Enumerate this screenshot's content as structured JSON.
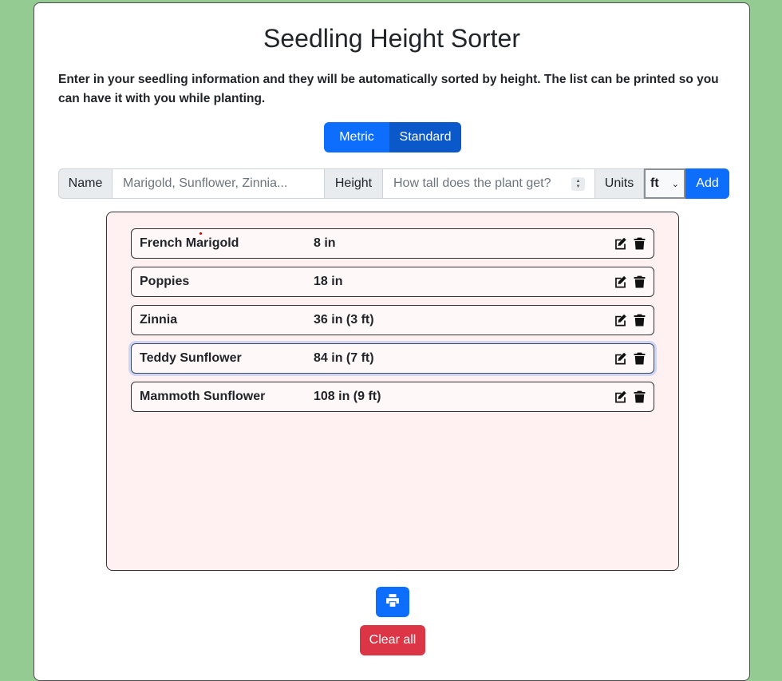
{
  "header": {
    "title": "Seedling Height Sorter",
    "description": "Enter in your seedling information and they will be automatically sorted by height. The list can be printed so you can have it with you while planting."
  },
  "unit_toggle": {
    "options": [
      "Metric",
      "Standard"
    ],
    "active": "Standard"
  },
  "form": {
    "name_label": "Name",
    "name_placeholder": "Marigold, Sunflower, Zinnia...",
    "height_label": "Height",
    "height_placeholder": "How tall does the plant get?",
    "units_label": "Units",
    "units_value": "ft",
    "add_label": "Add"
  },
  "list": {
    "items": [
      {
        "name": "French Marigold",
        "height": "8 in"
      },
      {
        "name": "Poppies",
        "height": "18 in"
      },
      {
        "name": "Zinnia",
        "height": "36 in (3 ft)"
      },
      {
        "name": "Teddy Sunflower",
        "height": "84 in (7 ft)"
      },
      {
        "name": "Mammoth Sunflower",
        "height": "108 in (9 ft)"
      }
    ]
  },
  "actions": {
    "print_icon": "printer-icon",
    "clear_label": "Clear all"
  },
  "colors": {
    "background": "#93cb92",
    "primary": "#0d6efd",
    "primary_active": "#0a58ca",
    "danger": "#dc3545",
    "list_bg": "#fff0f1"
  }
}
